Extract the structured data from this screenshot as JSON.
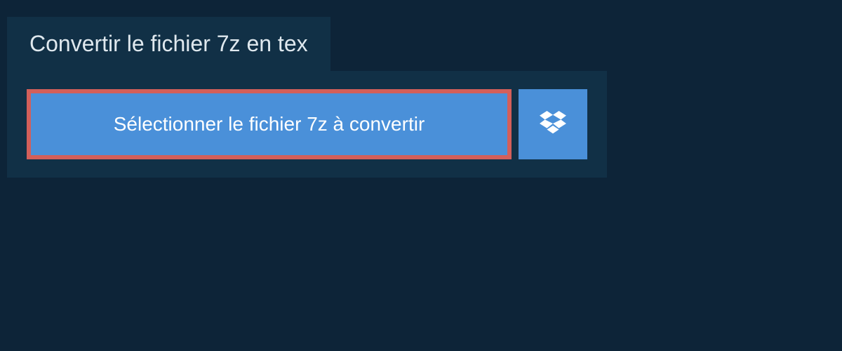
{
  "header": {
    "title": "Convertir le fichier 7z en tex"
  },
  "actions": {
    "select_file_label": "Sélectionner le fichier 7z à convertir"
  }
}
